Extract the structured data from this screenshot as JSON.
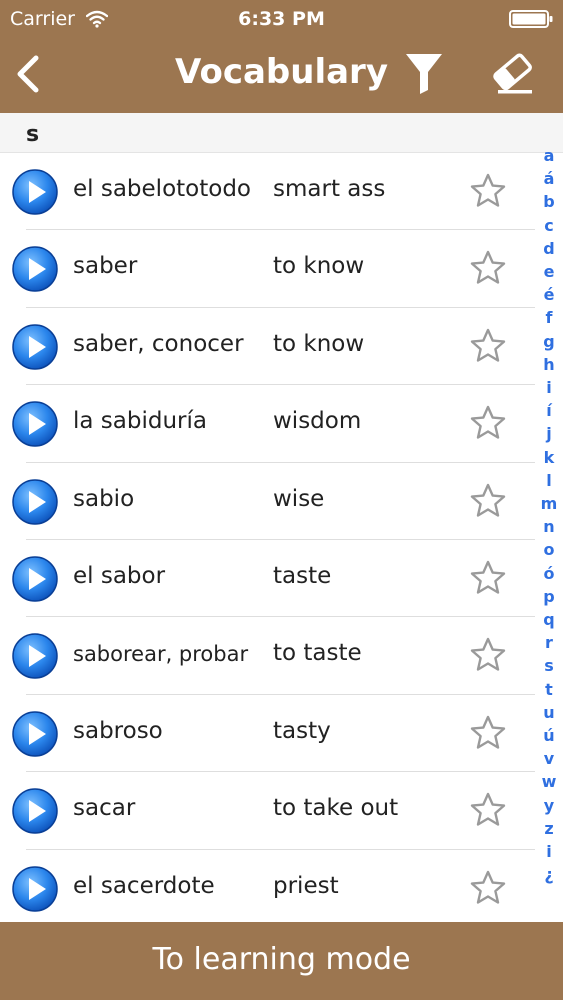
{
  "status_bar": {
    "carrier": "Carrier",
    "time": "6:33 PM",
    "wifi_icon": "wifi-icon",
    "battery_icon": "battery-icon"
  },
  "nav": {
    "title": "Vocabulary",
    "back_icon": "chevron-left-icon",
    "filter_icon": "filter-icon",
    "eraser_icon": "eraser-icon"
  },
  "section": {
    "letter": "s"
  },
  "rows": [
    {
      "spanish": "el sabelototodo",
      "english": "smart ass"
    },
    {
      "spanish": "saber",
      "english": "to know"
    },
    {
      "spanish": "saber, conocer",
      "english": "to know"
    },
    {
      "spanish": "la sabiduría",
      "english": "wisdom"
    },
    {
      "spanish": "sabio",
      "english": "wise"
    },
    {
      "spanish": "el sabor",
      "english": "taste"
    },
    {
      "spanish": "saborear, probar",
      "english": "to taste"
    },
    {
      "spanish": "sabroso",
      "english": "tasty"
    },
    {
      "spanish": "sacar",
      "english": "to take out"
    },
    {
      "spanish": "el sacerdote",
      "english": "priest"
    }
  ],
  "index_letters": [
    "a",
    "á",
    "b",
    "c",
    "d",
    "e",
    "é",
    "f",
    "g",
    "h",
    "i",
    "í",
    "j",
    "k",
    "l",
    "m",
    "n",
    "o",
    "ó",
    "p",
    "q",
    "r",
    "s",
    "t",
    "u",
    "ú",
    "v",
    "w",
    "y",
    "z",
    "i",
    "¿"
  ],
  "footer": {
    "label": "To learning mode"
  },
  "colors": {
    "header_brown": "#9c7650",
    "index_blue": "#2f6fe0",
    "play_blue": "#1f78e0"
  }
}
